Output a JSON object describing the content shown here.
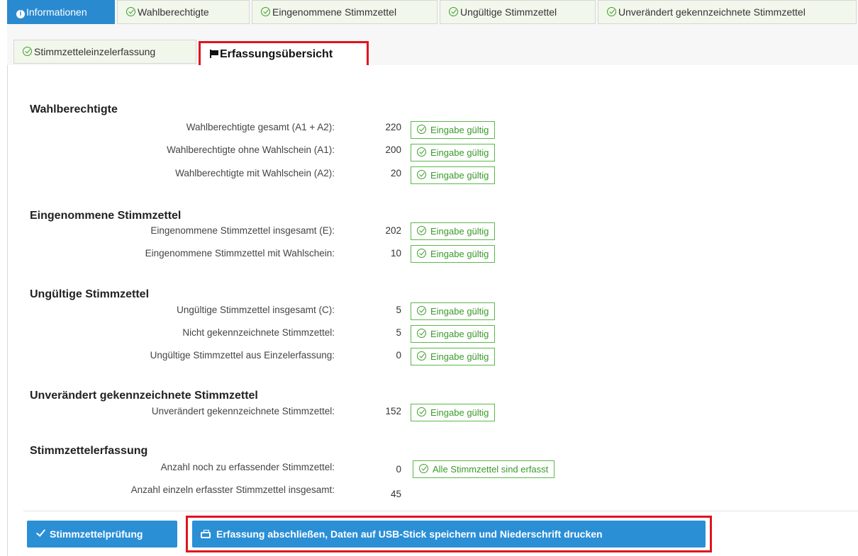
{
  "tabs": [
    {
      "label": "Informationen"
    },
    {
      "label": "Wahlberechtigte"
    },
    {
      "label": "Eingenommene Stimmzettel"
    },
    {
      "label": "Ungültige Stimmzettel"
    },
    {
      "label": "Unverändert gekennzeichnete Stimmzettel"
    },
    {
      "label": "Stimmzetteleinzelerfassung"
    },
    {
      "label": "Erfassungsübersicht"
    }
  ],
  "sections": {
    "wahlberechtigte": {
      "title": "Wahlberechtigte",
      "rows": [
        {
          "label": "Wahlberechtigte gesamt (A1 + A2):",
          "value": "220",
          "status": "Eingabe gültig"
        },
        {
          "label": "Wahlberechtigte ohne Wahlschein (A1):",
          "value": "200",
          "status": "Eingabe gültig"
        },
        {
          "label": "Wahlberechtigte mit Wahlschein (A2):",
          "value": "20",
          "status": "Eingabe gültig"
        }
      ]
    },
    "eingenommene": {
      "title": "Eingenommene Stimmzettel",
      "rows": [
        {
          "label": "Eingenommene Stimmzettel insgesamt (E):",
          "value": "202",
          "status": "Eingabe gültig"
        },
        {
          "label": "Eingenommene Stimmzettel mit Wahlschein:",
          "value": "10",
          "status": "Eingabe gültig"
        }
      ]
    },
    "ungueltige": {
      "title": "Ungültige Stimmzettel",
      "rows": [
        {
          "label": "Ungültige Stimmzettel insgesamt (C):",
          "value": "5",
          "status": "Eingabe gültig"
        },
        {
          "label": "Nicht gekennzeichnete Stimmzettel:",
          "value": "5",
          "status": "Eingabe gültig"
        },
        {
          "label": "Ungültige Stimmzettel aus Einzelerfassung:",
          "value": "0",
          "status": "Eingabe gültig"
        }
      ]
    },
    "unveraendert": {
      "title": "Unverändert gekennzeichnete Stimmzettel",
      "rows": [
        {
          "label": "Unverändert gekennzeichnete Stimmzettel:",
          "value": "152",
          "status": "Eingabe gültig"
        }
      ]
    },
    "erfassung": {
      "title": "Stimmzettelerfassung",
      "rows": [
        {
          "label": "Anzahl noch zu erfassender Stimmzettel:",
          "value": "0",
          "status": "Alle Stimmzettel sind erfasst"
        },
        {
          "label": "Anzahl einzeln erfasster Stimmzettel insgesamt:",
          "value": "45"
        }
      ]
    }
  },
  "buttons": {
    "check": "Stimmzettelprüfung",
    "finish": "Erfassung abschließen, Daten auf USB-Stick speichern und Niederschrift drucken"
  },
  "colors": {
    "primary": "#2b8fd6",
    "valid": "#3a9a2a",
    "highlight": "#e0141e"
  }
}
